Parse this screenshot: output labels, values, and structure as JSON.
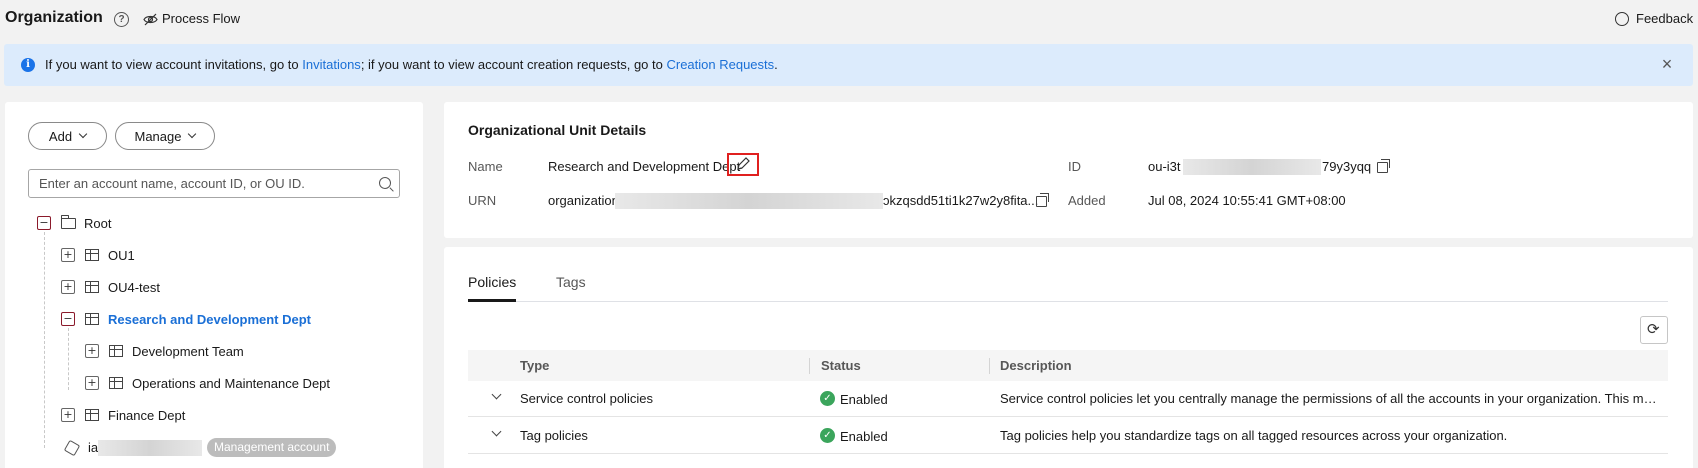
{
  "header": {
    "title": "Organization",
    "process_flow_label": "Process Flow",
    "feedback_label": "Feedback"
  },
  "banner": {
    "text_before": "If you want to view account invitations, go to ",
    "link_invitations": "Invitations",
    "text_middle": "; if you want to view account creation requests, go to ",
    "link_creation": "Creation Requests",
    "text_after": "."
  },
  "sidebar": {
    "add_label": "Add",
    "manage_label": "Manage",
    "search_placeholder": "Enter an account name, account ID, or OU ID.",
    "tree": [
      {
        "label": "Root",
        "toggle": "−"
      },
      {
        "label": "OU1",
        "toggle": "+"
      },
      {
        "label": "OU4-test",
        "toggle": "+"
      },
      {
        "label": "Research and Development Dept",
        "toggle": "−",
        "selected": true
      },
      {
        "label": "Development Team",
        "toggle": "+"
      },
      {
        "label": "Operations and Maintenance Dept",
        "toggle": "+"
      },
      {
        "label": "Finance Dept",
        "toggle": "+"
      },
      {
        "label": "ia",
        "badge": "Management account"
      }
    ]
  },
  "details": {
    "title": "Organizational Unit Details",
    "name_label": "Name",
    "name_value": "Research and Development Dept",
    "id_label": "ID",
    "id_prefix": "ou-i3t",
    "id_suffix": "79y3yqq",
    "urn_label": "URN",
    "urn_prefix": "organization",
    "urn_suffix": "ɔkzqsdd51ti1k27w2y8fita...",
    "added_label": "Added",
    "added_value": "Jul 08, 2024 10:55:41 GMT+08:00"
  },
  "tabs": [
    {
      "label": "Policies",
      "active": true
    },
    {
      "label": "Tags",
      "active": false
    }
  ],
  "table": {
    "columns": [
      "Type",
      "Status",
      "Description"
    ],
    "rows": [
      {
        "type": "Service control policies",
        "status": "Enabled",
        "description": "Service control policies let you centrally manage the permissions of all the accounts in your organization. This makes it ea..."
      },
      {
        "type": "Tag policies",
        "status": "Enabled",
        "description": "Tag policies help you standardize tags on all tagged resources across your organization."
      }
    ]
  }
}
